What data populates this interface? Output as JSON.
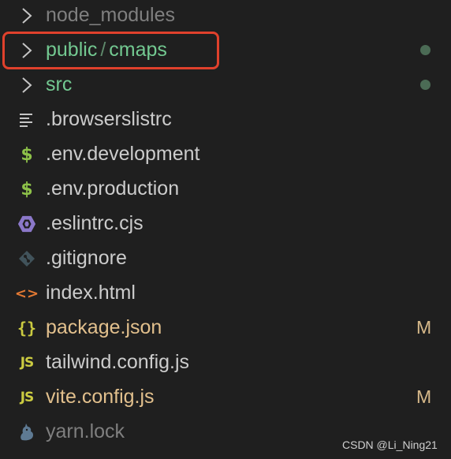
{
  "explorer": {
    "items": [
      {
        "name": "node_modules",
        "icon": "chevron-right-icon",
        "state": "ignored"
      },
      {
        "name": "public",
        "separator": "/",
        "subname": "cmaps",
        "icon": "chevron-right-icon",
        "state": "untracked-folder",
        "marker": "dot"
      },
      {
        "name": "src",
        "icon": "chevron-right-icon",
        "state": "untracked-folder",
        "marker": "dot"
      },
      {
        "name": ".browserslistrc",
        "icon": "lines-icon",
        "state": "normal"
      },
      {
        "name": ".env.development",
        "icon": "dollar-icon",
        "state": "normal"
      },
      {
        "name": ".env.production",
        "icon": "dollar-icon",
        "state": "normal"
      },
      {
        "name": ".eslintrc.cjs",
        "icon": "eslint-icon",
        "state": "normal"
      },
      {
        "name": ".gitignore",
        "icon": "git-icon",
        "state": "normal"
      },
      {
        "name": "index.html",
        "icon": "code-brackets-icon",
        "state": "normal"
      },
      {
        "name": "package.json",
        "icon": "braces-icon",
        "state": "modified",
        "badge": "M"
      },
      {
        "name": "tailwind.config.js",
        "icon": "js-icon",
        "state": "normal"
      },
      {
        "name": "vite.config.js",
        "icon": "js-icon",
        "state": "modified",
        "badge": "M"
      },
      {
        "name": "yarn.lock",
        "icon": "yarn-cat-icon",
        "state": "ignored"
      }
    ]
  },
  "watermark": "CSDN @Li_Ning21",
  "colors": {
    "background": "#1f1f1f",
    "text": "#cccccc",
    "ignored": "#7f7f7f",
    "untracked": "#73c991",
    "modified": "#e2c08d",
    "highlight": "#e0412c"
  }
}
